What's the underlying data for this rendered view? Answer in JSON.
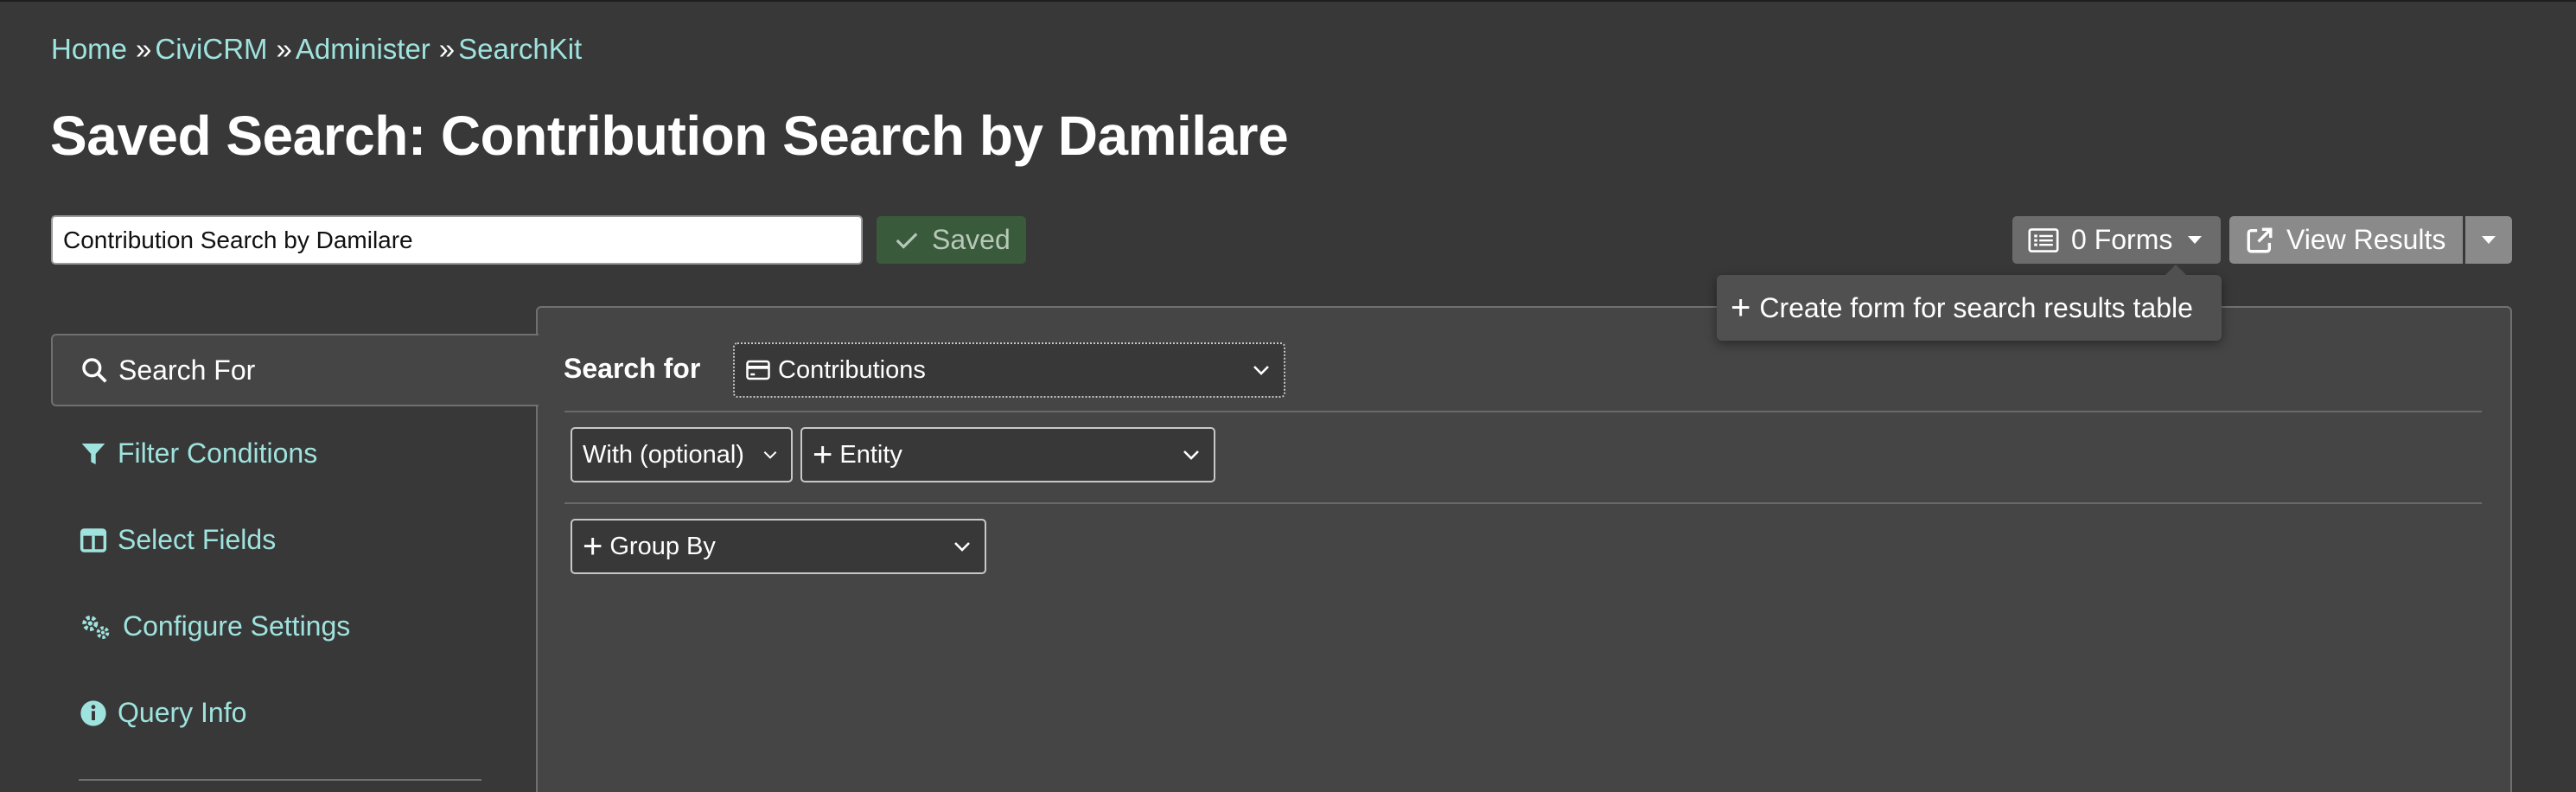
{
  "breadcrumb": [
    {
      "label": "Home"
    },
    {
      "label": "CiviCRM"
    },
    {
      "label": "Administer"
    },
    {
      "label": "SearchKit"
    }
  ],
  "breadcrumb_separator": "»",
  "page_title": "Saved Search: Contribution Search by Damilare",
  "search_name_input": {
    "value": "Contribution Search by Damilare"
  },
  "status": {
    "saved_label": "Saved"
  },
  "toolbar": {
    "forms_label": "0 Forms",
    "view_results_label": "View Results"
  },
  "forms_menu": {
    "items": [
      {
        "label": "Create form for search results table",
        "icon": "plus-icon"
      }
    ]
  },
  "sidebar": {
    "active_tab": {
      "label": "Search For",
      "icon": "search-icon"
    },
    "items": [
      {
        "label": "Filter Conditions",
        "icon": "filter-icon"
      },
      {
        "label": "Select Fields",
        "icon": "columns-icon"
      },
      {
        "label": "Configure Settings",
        "icon": "gears-icon"
      },
      {
        "label": "Query Info",
        "icon": "info-circle-icon"
      }
    ]
  },
  "main": {
    "search_for_label": "Search for",
    "entity_select": {
      "value": "Contributions",
      "icon": "credit-card-icon"
    },
    "join_select": {
      "value": "With (optional)"
    },
    "entity_join_select": {
      "value": "Entity",
      "icon": "plus-icon"
    },
    "group_by_select": {
      "value": "Group By",
      "icon": "plus-icon"
    }
  },
  "colors": {
    "background": "#383838",
    "panel": "#454545",
    "link": "#9fe3de",
    "saved_badge": "#3a5a3c",
    "forms_button": "#6c6c6c",
    "view_button": "#8a8a8a"
  }
}
